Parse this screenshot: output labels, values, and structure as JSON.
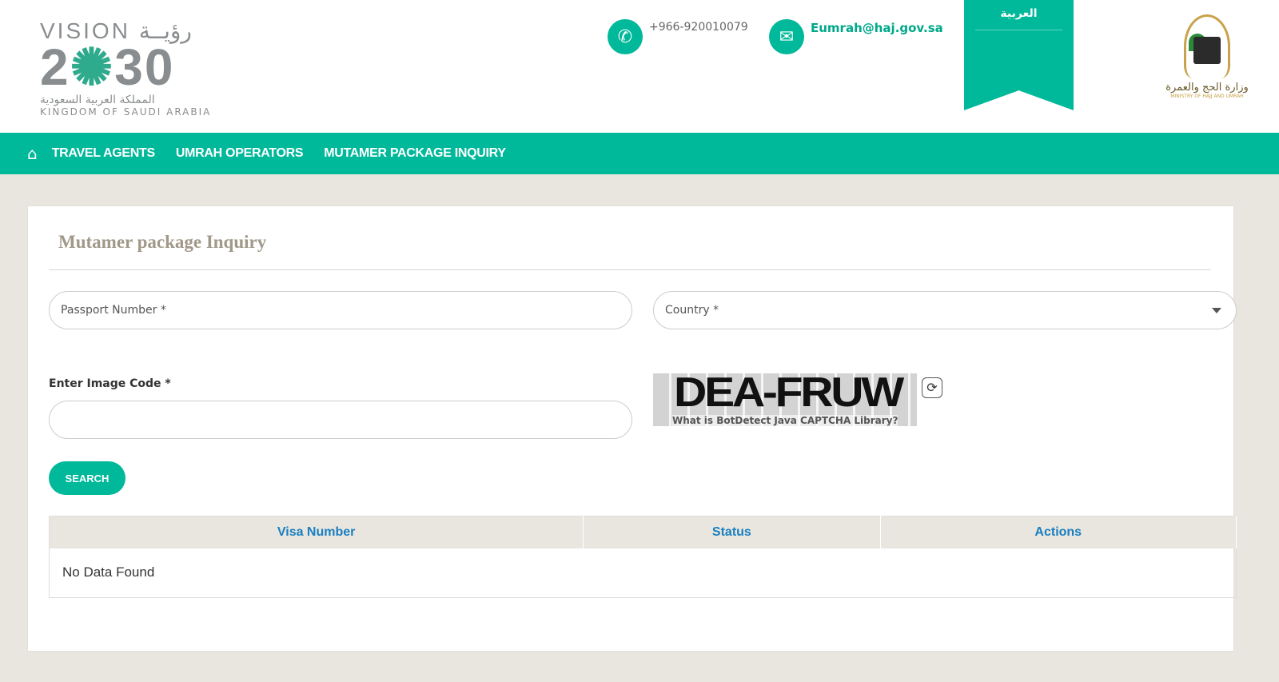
{
  "header": {
    "logo": {
      "line1": "VISION رؤيــة",
      "line2a": "2",
      "line2b": "✺",
      "line2c": "30",
      "arabic": "المملكة العربية السعودية",
      "english": "KINGDOM OF SAUDI ARABIA"
    },
    "phone": "+966-920010079",
    "email": "Eumrah@haj.gov.sa",
    "language": "العربية",
    "ministry": {
      "arabic": "وزارة الحج والعمرة",
      "english": "MINISTRY OF HAJJ AND UMRAH"
    }
  },
  "nav": {
    "home_icon": "home-icon",
    "items": [
      "TRAVEL AGENTS",
      "UMRAH OPERATORS",
      "MUTAMER PACKAGE INQUIRY"
    ]
  },
  "colors": {
    "accent": "#00b89a",
    "header_link": "#1a7fc0"
  },
  "form": {
    "title": "Mutamer package Inquiry",
    "passport_placeholder": "Passport Number *",
    "country_placeholder": "Country *",
    "image_code_label": "Enter Image Code *",
    "image_code_value": "",
    "captcha_text": "DEA-FRUW",
    "captcha_link": "What is BotDetect Java CAPTCHA Library?",
    "search_label": "SEARCH"
  },
  "table": {
    "columns": [
      "Visa Number",
      "Status",
      "Actions"
    ],
    "empty": "No Data Found"
  }
}
